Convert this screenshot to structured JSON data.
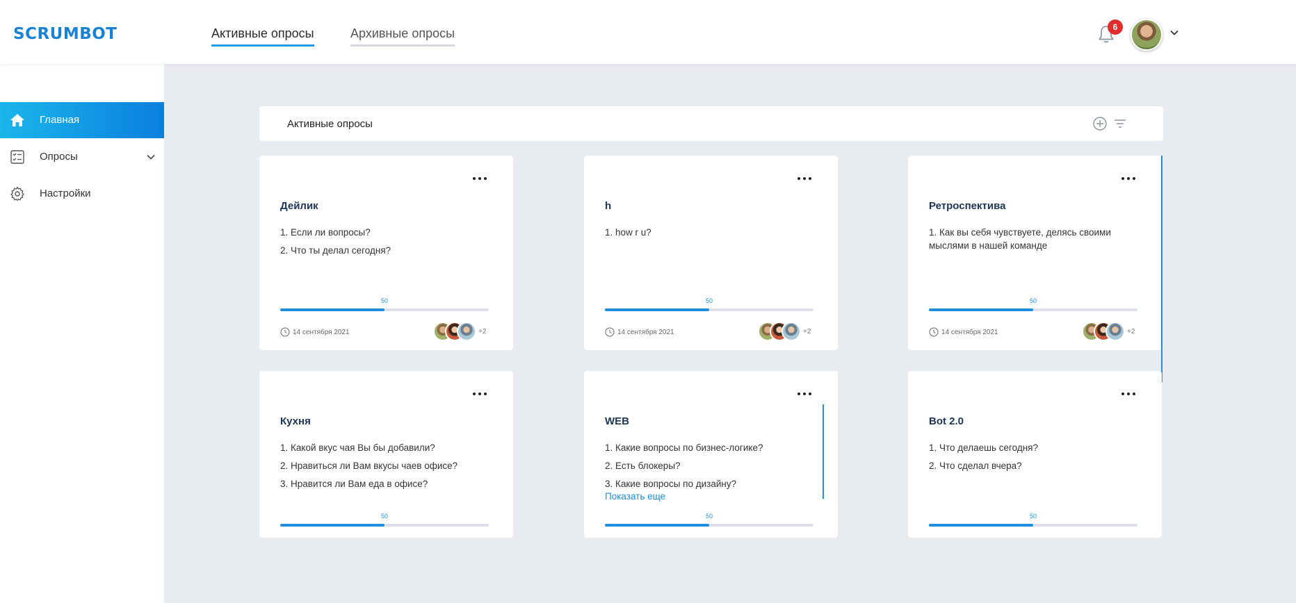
{
  "header": {
    "logo": "SCRUMBOT",
    "tabs": [
      {
        "label": "Активные опросы",
        "active": true
      },
      {
        "label": "Архивные опросы",
        "active": false
      }
    ],
    "notifications_count": "6"
  },
  "sidebar": {
    "items": [
      {
        "label": "Главная",
        "icon": "home-icon",
        "active": true
      },
      {
        "label": "Опросы",
        "icon": "checklist-icon",
        "active": false
      },
      {
        "label": "Настройки",
        "icon": "gear-icon",
        "active": false
      }
    ]
  },
  "panel": {
    "title": "Активные опросы"
  },
  "cards": [
    {
      "title": "Дейлик",
      "questions": [
        "1. Если ли вопросы?",
        "2. Что ты делал сегодня?"
      ],
      "progress_label": "50",
      "progress": 0.5,
      "date": "14 сентября 2021",
      "extra_participants": "+2"
    },
    {
      "title": "h",
      "questions": [
        "1. how r u?"
      ],
      "progress_label": "50",
      "progress": 0.5,
      "date": "14 сентября 2021",
      "extra_participants": "+2"
    },
    {
      "title": "Ретроспектива",
      "questions": [
        "1. Как вы себя чувствуете, делясь своими мыслями в нашей команде"
      ],
      "progress_label": "50",
      "progress": 0.5,
      "date": "14 сентября 2021",
      "extra_participants": "+2"
    },
    {
      "title": "Кухня",
      "questions": [
        "1. Какой вкус чая Вы бы добавили?",
        "2. Нравиться ли Вам вкусы чаев офисе?",
        "3. Нравится ли Вам еда в офисе?"
      ],
      "progress_label": "50",
      "progress": 0.5
    },
    {
      "title": "WEB",
      "questions": [
        "1. Какие вопросы по бизнес-логике?",
        "2. Есть блокеры?",
        "3. Какие вопросы по дизайну?"
      ],
      "show_more": "Показать еще",
      "progress_label": "50",
      "progress": 0.5
    },
    {
      "title": "Bot 2.0",
      "questions": [
        "1. Что делаешь сегодня?",
        "2. Что сделал вчера?"
      ],
      "progress_label": "50",
      "progress": 0.5
    }
  ],
  "colors": {
    "accent": "#1d8ee0",
    "badge": "#e22d2d",
    "background": "#e8ebf0"
  }
}
